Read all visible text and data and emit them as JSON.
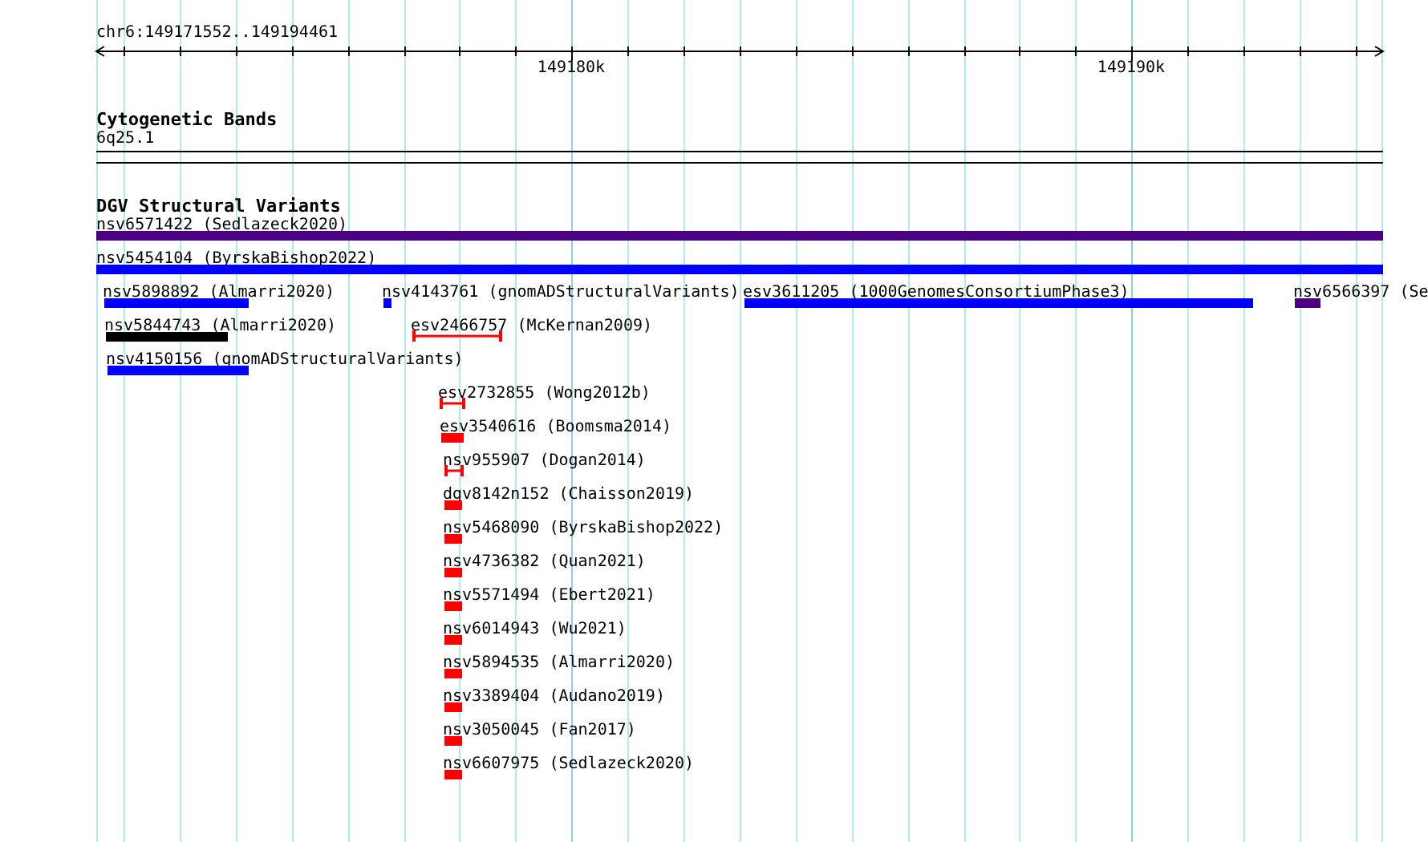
{
  "ruler": {
    "location": "chr6:149171552..149194461",
    "tick_labels": [
      "149180k",
      "149190k"
    ]
  },
  "cytogenetic_bands": {
    "title": "Cytogenetic Bands",
    "band": "6q25.1"
  },
  "dgv_variants": {
    "title": "DGV Structural Variants",
    "features": [
      {
        "label": "nsv6571422 (Sedlazeck2020)",
        "kind": "bar",
        "color": "#4b0082"
      },
      {
        "label": "nsv5454104 (ByrskaBishop2022)",
        "kind": "bar",
        "color": "#0000ff"
      },
      {
        "label": "nsv5898892 (Almarri2020)",
        "kind": "bar",
        "color": "#0000ff"
      },
      {
        "label": "nsv4143761 (gnomADStructuralVariants)",
        "kind": "bar",
        "color": "#0000ff"
      },
      {
        "label": "esv3611205 (1000GenomesConsortiumPhase3)",
        "kind": "bar",
        "color": "#0000ff"
      },
      {
        "label": "nsv6566397 (Se",
        "kind": "bar",
        "color": "#4b0082"
      },
      {
        "label": "nsv5844743 (Almarri2020)",
        "kind": "bar",
        "color": "#000000"
      },
      {
        "label": "esv2466757 (McKernan2009)",
        "kind": "interval",
        "color": "#ff0000"
      },
      {
        "label": "nsv4150156 (gnomADStructuralVariants)",
        "kind": "bar",
        "color": "#0000ff"
      },
      {
        "label": "esv2732855 (Wong2012b)",
        "kind": "interval",
        "color": "#ff0000"
      },
      {
        "label": "esv3540616 (Boomsma2014)",
        "kind": "bar",
        "color": "#ff0000"
      },
      {
        "label": "nsv955907 (Dogan2014)",
        "kind": "interval",
        "color": "#ff0000"
      },
      {
        "label": "dgv8142n152 (Chaisson2019)",
        "kind": "bar",
        "color": "#ff0000"
      },
      {
        "label": "nsv5468090 (ByrskaBishop2022)",
        "kind": "bar",
        "color": "#ff0000"
      },
      {
        "label": "nsv4736382 (Quan2021)",
        "kind": "bar",
        "color": "#ff0000"
      },
      {
        "label": "nsv5571494 (Ebert2021)",
        "kind": "bar",
        "color": "#ff0000"
      },
      {
        "label": "nsv6014943 (Wu2021)",
        "kind": "bar",
        "color": "#ff0000"
      },
      {
        "label": "nsv5894535 (Almarri2020)",
        "kind": "bar",
        "color": "#ff0000"
      },
      {
        "label": "nsv3389404 (Audano2019)",
        "kind": "bar",
        "color": "#ff0000"
      },
      {
        "label": "nsv3050045 (Fan2017)",
        "kind": "bar",
        "color": "#ff0000"
      },
      {
        "label": "nsv6607975 (Sedlazeck2020)",
        "kind": "bar",
        "color": "#ff0000"
      }
    ]
  }
}
